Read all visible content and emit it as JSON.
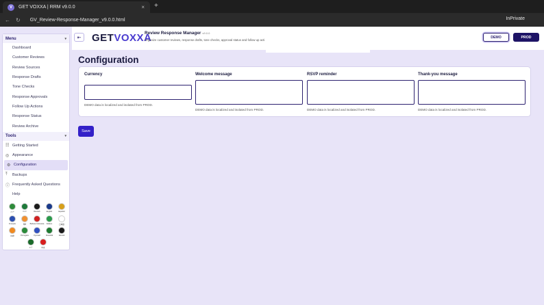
{
  "browser": {
    "tab_title": "GET VOXXA | RRM v9.0.0",
    "tab_close": "×",
    "new_tab": "+",
    "url": "GV_Review-Response-Manager_v9.0.0.html",
    "mode": "InPrivate",
    "back": "←",
    "reload": "↻"
  },
  "sidebar": {
    "menu_title": "Menu",
    "menu_items": [
      "Dashboard",
      "Customer Reviews",
      "Review Sources",
      "Response Drafts",
      "Tone Checks",
      "Response Approvals",
      "Follow Up Actions",
      "Response Status",
      "Review Archive"
    ],
    "tools_title": "Tools",
    "tools_items": [
      "Getting Started",
      "Appearance",
      "Configuration",
      "Backups",
      "Frequently Asked Questions",
      "Help"
    ],
    "active_item": "Configuration",
    "chevron": "▾"
  },
  "flags": [
    [
      {
        "label": "عربي",
        "color": "#2e8b3a"
      },
      {
        "label": "বাংলা",
        "color": "#1f7a3a"
      },
      {
        "label": "Deutsch",
        "color": "#1b1b1b"
      },
      {
        "label": "English",
        "color": "#1a3a8a"
      },
      {
        "label": "Español",
        "color": "#d8a01a"
      }
    ],
    [
      {
        "label": "Français",
        "color": "#2b4fb0"
      },
      {
        "label": "हिंदी",
        "color": "#f09030"
      },
      {
        "label": "Bahasa Indonesia",
        "color": "#d02020"
      },
      {
        "label": "Italiano",
        "color": "#2a9a4a"
      },
      {
        "label": "日本語",
        "color": "#ffffff"
      }
    ],
    [
      {
        "label": "मराठी",
        "color": "#f08a20"
      },
      {
        "label": "Português",
        "color": "#2a8a3a"
      },
      {
        "label": "Русский",
        "color": "#3050c0"
      },
      {
        "label": "Kiswahili",
        "color": "#1e7a30"
      },
      {
        "label": "Ikirundi",
        "color": "#1a1a1a"
      }
    ],
    [
      {
        "label": "اردو",
        "color": "#1a6a2a"
      },
      {
        "label": "中文",
        "color": "#d81e1e"
      }
    ]
  ],
  "header": {
    "menu_toggle": "⇤",
    "logo_prefix": "GET",
    "logo_accent": "VOXXA",
    "app_title": "Review Response Manager",
    "app_version": "v9.0.0",
    "app_subtitle": "Organize customer reviews, response drafts, tone checks, approval status and follow up acti",
    "btn_demo": "DEMO",
    "btn_prod": "PROD"
  },
  "main": {
    "title": "Configuration",
    "fields": [
      {
        "label": "Currency",
        "value": "",
        "hint": "DEMO data is localized and isolated from PROD."
      },
      {
        "label": "Welcome message",
        "value": "",
        "hint": "DEMO data is localized and isolated from PROD."
      },
      {
        "label": "RSVP reminder",
        "value": "",
        "hint": "DEMO data is localized and isolated from PROD."
      },
      {
        "label": "Thank-you message",
        "value": "",
        "hint": "DEMO data is localized and isolated from PROD."
      }
    ],
    "save_label": "Save"
  },
  "colors": {
    "accent": "#3320c8",
    "brand_dark": "#1e1466",
    "page_bg": "#e8e4f8"
  }
}
